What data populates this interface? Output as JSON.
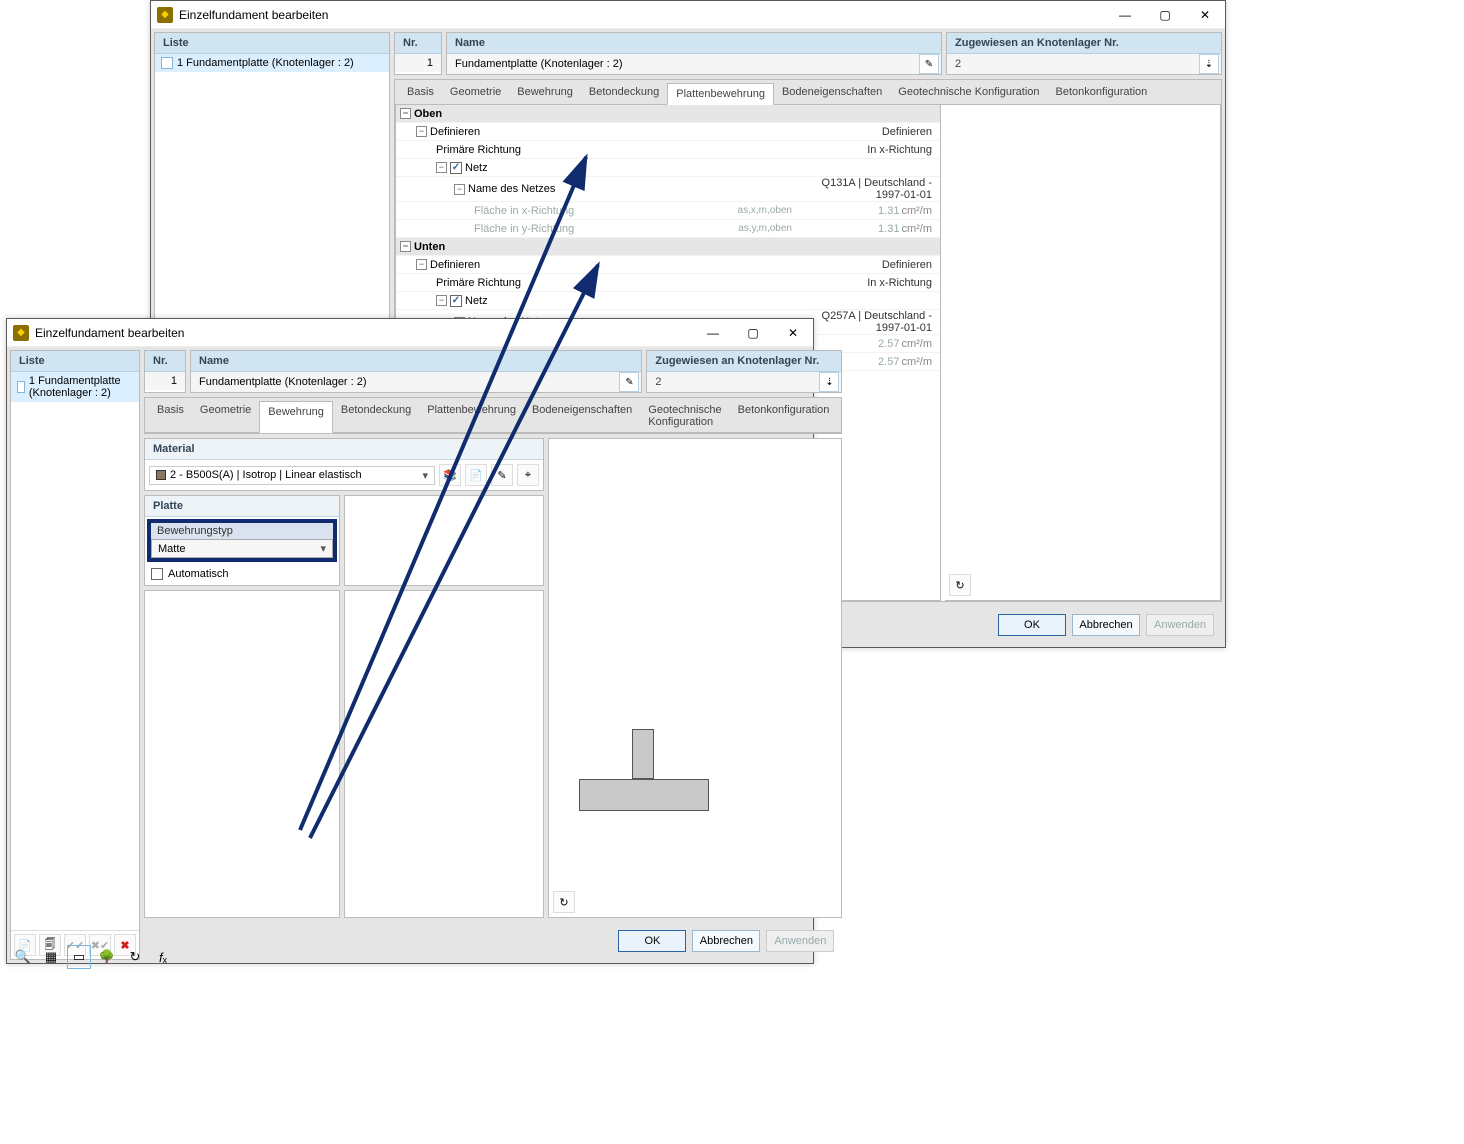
{
  "win1": {
    "title": "Einzelfundament bearbeiten",
    "list_header": "Liste",
    "list_item": "1  Fundamentplatte (Knotenlager : 2)",
    "nr_header": "Nr.",
    "nr_value": "1",
    "name_header": "Name",
    "name_value": "Fundamentplatte (Knotenlager : 2)",
    "assign_header": "Zugewiesen an Knotenlager Nr.",
    "assign_value": "2",
    "tabs": {
      "basis": "Basis",
      "geometrie": "Geometrie",
      "bewehrung": "Bewehrung",
      "betondeckung": "Betondeckung",
      "plattenbewehrung": "Plattenbewehrung",
      "bodeneigenschaften": "Bodeneigenschaften",
      "geotech": "Geotechnische Konfiguration",
      "betonkonfig": "Betonkonfiguration"
    },
    "tree": {
      "oben": "Oben",
      "unten": "Unten",
      "definieren": "Definieren",
      "definieren_r": "Definieren",
      "prim_richtung": "Primäre Richtung",
      "prim_r_val": "In x-Richtung",
      "netz": "Netz",
      "netzname": "Name des Netzes",
      "netz1_val": "Q131A | Deutschland - 1997-01-01",
      "netz2_val": "Q257A | Deutschland - 1997-01-01",
      "flx": "Fläche in x-Richtung",
      "fly": "Fläche in y-Richtung",
      "as_x_oben": "as,x,m,oben",
      "as_y_oben": "as,y,m,oben",
      "v131": "1.31",
      "v257": "2.57",
      "unit": "cm²/m"
    },
    "buttons": {
      "ok": "OK",
      "cancel": "Abbrechen",
      "apply": "Anwenden"
    }
  },
  "win2": {
    "title": "Einzelfundament bearbeiten",
    "list_header": "Liste",
    "list_item": "1  Fundamentplatte (Knotenlager : 2)",
    "nr_header": "Nr.",
    "nr_value": "1",
    "name_header": "Name",
    "name_value": "Fundamentplatte (Knotenlager : 2)",
    "assign_header": "Zugewiesen an Knotenlager Nr.",
    "assign_value": "2",
    "tabs": {
      "basis": "Basis",
      "geometrie": "Geometrie",
      "bewehrung": "Bewehrung",
      "betondeckung": "Betondeckung",
      "plattenbewehrung": "Plattenbewehrung",
      "bodeneigenschaften": "Bodeneigenschaften",
      "geotech": "Geotechnische Konfiguration",
      "betonkonfig": "Betonkonfiguration"
    },
    "material_hdr": "Material",
    "material_val": "2 - B500S(A) | Isotrop | Linear elastisch",
    "platte_hdr": "Platte",
    "bewtyp_label": "Bewehrungstyp",
    "bewtyp_value": "Matte",
    "auto_label": "Automatisch",
    "buttons": {
      "ok": "OK",
      "cancel": "Abbrechen",
      "apply": "Anwenden"
    }
  }
}
